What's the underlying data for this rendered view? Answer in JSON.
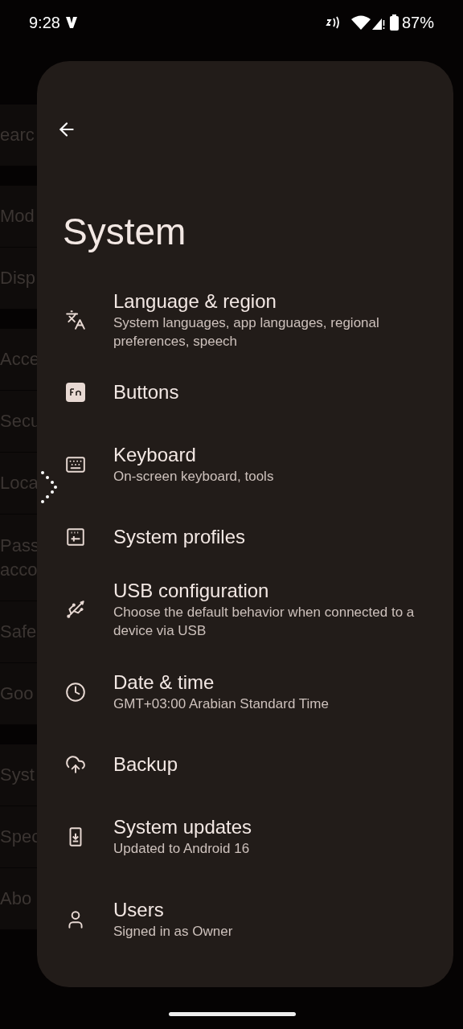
{
  "status_bar": {
    "time": "9:28",
    "battery": "87%"
  },
  "background_sections": [
    {
      "rows": [
        [
          "earc"
        ]
      ]
    },
    {
      "rows": [
        [
          "Mod"
        ],
        [
          "Disp"
        ]
      ]
    },
    {
      "rows": [
        [
          "Acce"
        ],
        [
          "Secu"
        ],
        [
          "Loca"
        ],
        [
          "Pass",
          "acco"
        ],
        [
          "Safe"
        ],
        [
          "Goo"
        ]
      ]
    },
    {
      "rows": [
        [
          "Syst"
        ],
        [
          "Spec"
        ],
        [
          "Abo"
        ]
      ]
    }
  ],
  "panel": {
    "title": "System",
    "items": [
      {
        "kind": "language",
        "title": "Language & region",
        "subtitle": "System languages, app languages, regional preferences, speech"
      },
      {
        "kind": "buttons",
        "title": "Buttons"
      },
      {
        "kind": "keyboard",
        "title": "Keyboard",
        "subtitle": "On-screen keyboard, tools"
      },
      {
        "kind": "profiles",
        "title": "System profiles"
      },
      {
        "kind": "usb",
        "title": "USB configuration",
        "subtitle": "Choose the default behavior when connected to a device via USB"
      },
      {
        "kind": "clock",
        "title": "Date & time",
        "subtitle": "GMT+03:00 Arabian Standard Time"
      },
      {
        "kind": "backup",
        "title": "Backup"
      },
      {
        "kind": "update",
        "title": "System updates",
        "subtitle": "Updated to Android 16"
      },
      {
        "kind": "user",
        "title": "Users",
        "subtitle": "Signed in as Owner"
      }
    ]
  }
}
